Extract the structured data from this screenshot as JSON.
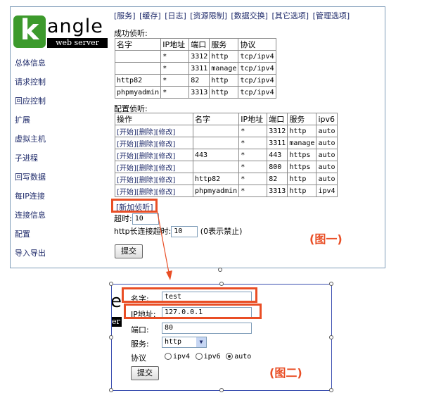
{
  "logo": {
    "letter": "k",
    "word": "angle",
    "tagline": "web server"
  },
  "sidebar": {
    "items": [
      "总体信息",
      "请求控制",
      "回应控制",
      "扩展",
      "虚拟主机",
      "子进程",
      "回写数据",
      "每IP连接",
      "连接信息",
      "配置",
      "导入导出"
    ]
  },
  "top_menu": {
    "items": [
      "[服务]",
      "[缓存]",
      "[日志]",
      "[资源限制]",
      "[数据交换]",
      "[其它选项]",
      "[管理选项]"
    ]
  },
  "success_listen": {
    "label": "成功侦听:",
    "headers": [
      "名字",
      "IP地址",
      "端口",
      "服务",
      "协议"
    ],
    "rows": [
      [
        "",
        "*",
        "3312",
        "http",
        "tcp/ipv4"
      ],
      [
        "",
        "*",
        "3311",
        "manage",
        "tcp/ipv4"
      ],
      [
        "http82",
        "*",
        "82",
        "http",
        "tcp/ipv4"
      ],
      [
        "phpmyadmin",
        "*",
        "3313",
        "http",
        "tcp/ipv4"
      ]
    ]
  },
  "config_listen": {
    "label": "配置侦听:",
    "headers": [
      "操作",
      "名字",
      "IP地址",
      "端口",
      "服务",
      "ipv6"
    ],
    "ops": [
      "[开始]",
      "[删除]",
      "[修改]"
    ],
    "rows": [
      [
        "",
        "*",
        "3312",
        "http",
        "auto"
      ],
      [
        "",
        "*",
        "3311",
        "manage",
        "auto"
      ],
      [
        "443",
        "*",
        "443",
        "https",
        "auto"
      ],
      [
        "",
        "*",
        "800",
        "https",
        "auto"
      ],
      [
        "http82",
        "*",
        "82",
        "http",
        "auto"
      ],
      [
        "phpmyadmin",
        "*",
        "3313",
        "http",
        "ipv4"
      ]
    ]
  },
  "new_listen_link": "[新加侦听]",
  "timeout": {
    "label": "超时:",
    "value": "10"
  },
  "keepalive": {
    "label": "http长连接超时:",
    "value": "10",
    "note": "(0表示禁止)"
  },
  "submit_label": "提交",
  "caption1": "(图一)",
  "caption2": "(图二)",
  "fig2": {
    "logo_fragment": "e",
    "logo_bar": "er",
    "name_label": "名字:",
    "name_value": "test",
    "ip_label": "IP地址:",
    "ip_value": "127.0.0.1",
    "port_label": "端口:",
    "port_value": "80",
    "service_label": "服务:",
    "service_value": "http",
    "protocol_label": "协议",
    "protocol_options": [
      "ipv4",
      "ipv6",
      "auto"
    ],
    "protocol_selected": "auto",
    "submit_label": "提交"
  },
  "colors": {
    "highlight": "#e94e25",
    "link": "#1e2a6a",
    "logo_green": "#3c9a2c",
    "frame_blue": "#3b4fb0"
  }
}
